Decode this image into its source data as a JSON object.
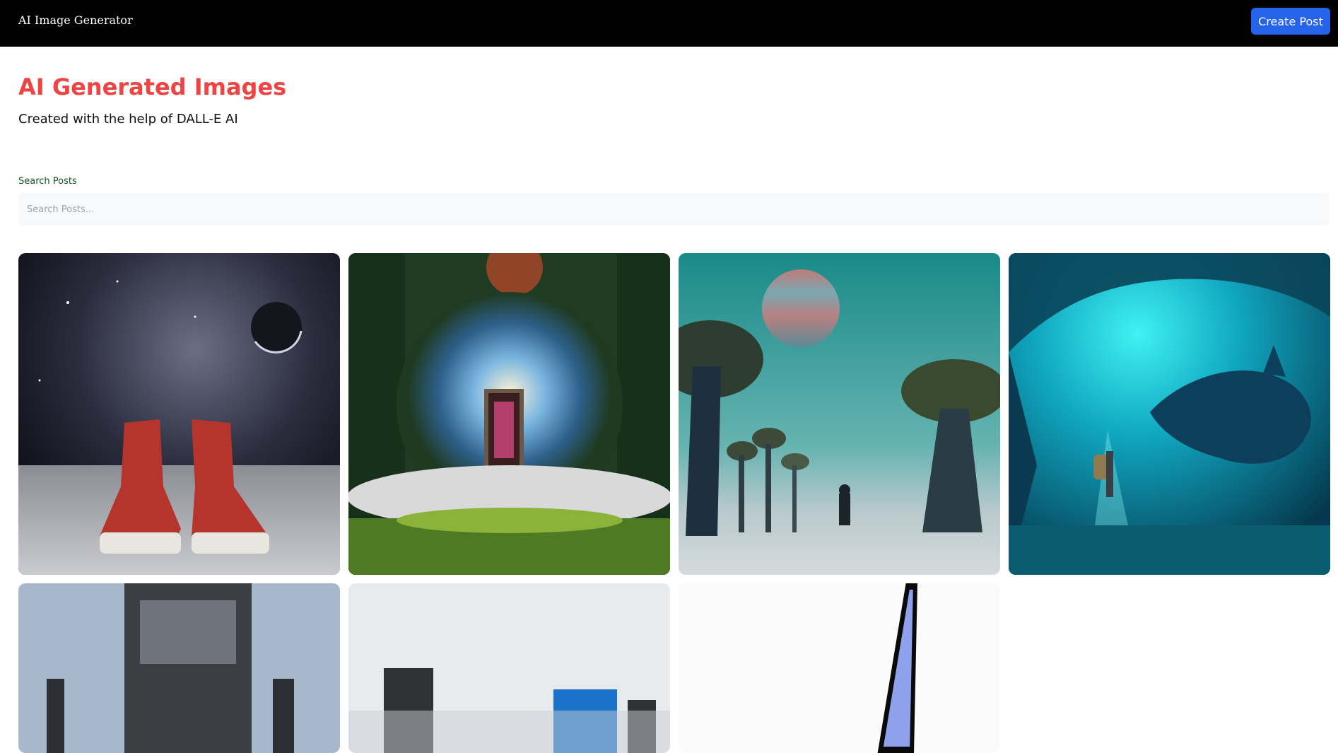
{
  "header": {
    "app_title": "AI Image Generator",
    "create_button_label": "Create Post"
  },
  "hero": {
    "title": "AI Generated Images",
    "subtitle": "Created with the help of DALL-E AI"
  },
  "search": {
    "label": "Search Posts",
    "placeholder": "Search Posts...",
    "value": ""
  },
  "colors": {
    "header_bg": "#000000",
    "accent": "#ef4444",
    "button": "#2563eb",
    "label": "#14532d"
  },
  "posts": [
    {
      "image": "sneakers-on-moon-image"
    },
    {
      "image": "portal-door-image"
    },
    {
      "image": "alien-trees-planet-image"
    },
    {
      "image": "underwater-diver-image"
    },
    {
      "image": "crashed-car-image"
    },
    {
      "image": "office-computer-image"
    },
    {
      "image": "blue-crystal-image"
    }
  ]
}
